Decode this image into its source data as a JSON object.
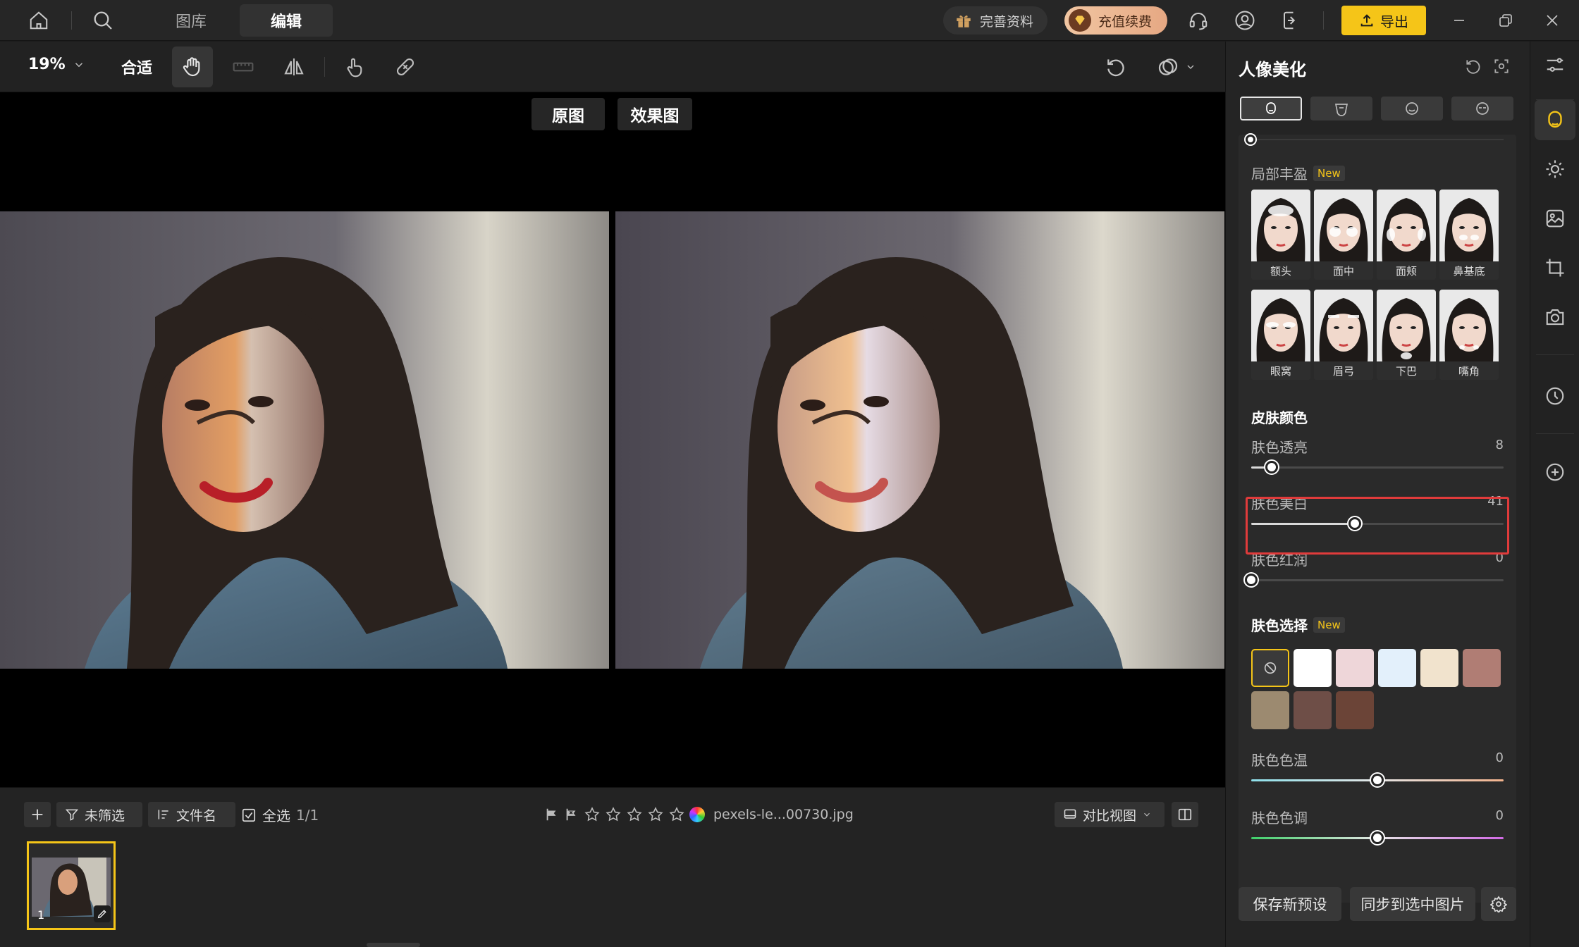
{
  "topbar": {
    "tabs": [
      "图库",
      "编辑"
    ],
    "profile_label": "完善资料",
    "vip_label": "充值续费",
    "export_label": "导出"
  },
  "toolbar": {
    "zoom": "19%",
    "fit_label": "合适"
  },
  "canvas": {
    "original_label": "原图",
    "effect_label": "效果图"
  },
  "filmstrip": {
    "filter_label": "未筛选",
    "sort_label": "文件名",
    "select_all_label": "全选",
    "count": "1/1",
    "filename": "pexels-le...00730.jpg",
    "view_label": "对比视图",
    "thumb_index": "1"
  },
  "panel": {
    "title": "人像美化",
    "local_fill": {
      "title": "局部丰盈",
      "new_tag": "New",
      "faces": [
        "额头",
        "面中",
        "面颊",
        "鼻基底",
        "眼窝",
        "眉弓",
        "下巴",
        "嘴角"
      ]
    },
    "skin_color": {
      "title": "皮肤颜色",
      "sliders": [
        {
          "label": "肤色透亮",
          "value": "8",
          "fraction": 0.08
        },
        {
          "label": "肤色美白",
          "value": "41",
          "fraction": 0.41
        },
        {
          "label": "肤色红润",
          "value": "0",
          "fraction": 0.0
        }
      ]
    },
    "skin_select": {
      "title": "肤色选择",
      "new_tag": "New",
      "swatches": [
        "none",
        "#ffffff",
        "#eed6d9",
        "#e3f0fb",
        "#f1e3cd",
        "#b07d74",
        "#9c8a70",
        "#6e4e47",
        "#6b4437"
      ]
    },
    "temp_sliders": [
      {
        "label": "肤色色温",
        "value": "0",
        "fraction": 0.5
      },
      {
        "label": "肤色色调",
        "value": "0",
        "fraction": 0.5
      }
    ],
    "save_preset": "保存新预设",
    "sync_label": "同步到选中图片"
  },
  "colors": {
    "accent": "#f5c518",
    "highlight": "#e03b3b"
  }
}
